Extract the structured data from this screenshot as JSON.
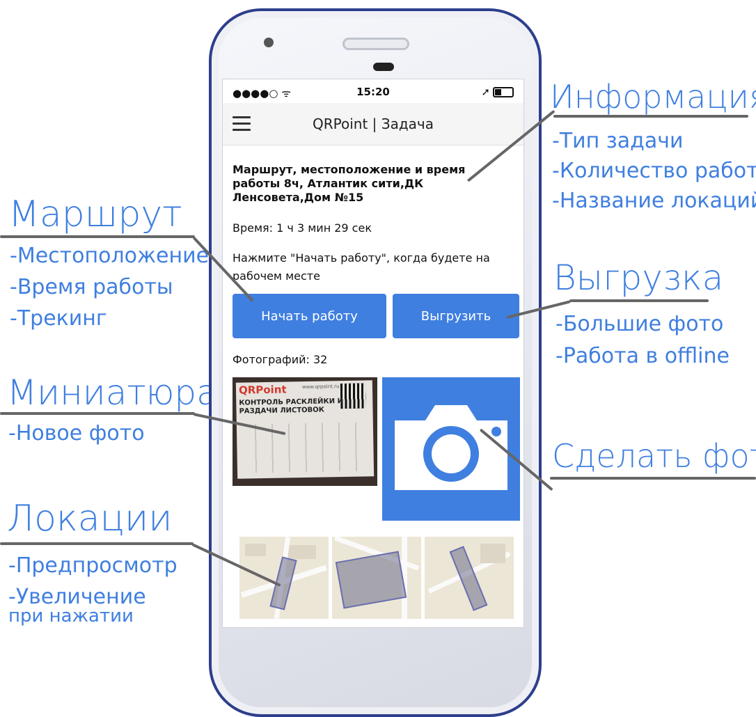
{
  "statusbar": {
    "signal": "●●●●○ ᯤ",
    "time": "15:20",
    "right_icons": "➚"
  },
  "app": {
    "title": "QRPoint | Задача"
  },
  "task": {
    "title": "Маршрут, местоположение и время работы 8ч, Атлантик сити,ДК Ленсовета,Дом №15",
    "time_text": "Время: 1 ч 3 мин 29 сек",
    "hint": "Нажмите \"Начать работу\", когда будете на рабочем месте"
  },
  "buttons": {
    "start": "Начать работу",
    "upload": "Выгрузить"
  },
  "photos": {
    "count_text": "Фотографий: 32",
    "thumb": {
      "logo": "QRPoint",
      "url": "www.qrpoint.ru",
      "line1": "КОНТРОЛЬ РАСКЛЕЙКИ И",
      "line2": "РАЗДАЧИ ЛИСТОВОК"
    }
  },
  "annotations": {
    "info": {
      "title": "Информация",
      "items": [
        "-Тип задачи",
        "-Количество работы",
        "-Название локаций"
      ]
    },
    "route": {
      "title": "Маршрут",
      "items": [
        "-Местоположение",
        "-Время работы",
        "-Трекинг"
      ]
    },
    "upload": {
      "title": "Выгрузка",
      "items": [
        "-Большие фото",
        "-Работа в offline"
      ]
    },
    "thumb": {
      "title": "Миниатюра",
      "items": [
        "-Новое фото"
      ]
    },
    "photo": {
      "title": "Сделать фото"
    },
    "locations": {
      "title": "Локации",
      "items": [
        "-Предпросмотр",
        "-Увеличение",
        "при нажатии"
      ]
    }
  },
  "colors": {
    "accent": "#3f7fe0",
    "phone_frame": "#2d3f8c"
  }
}
